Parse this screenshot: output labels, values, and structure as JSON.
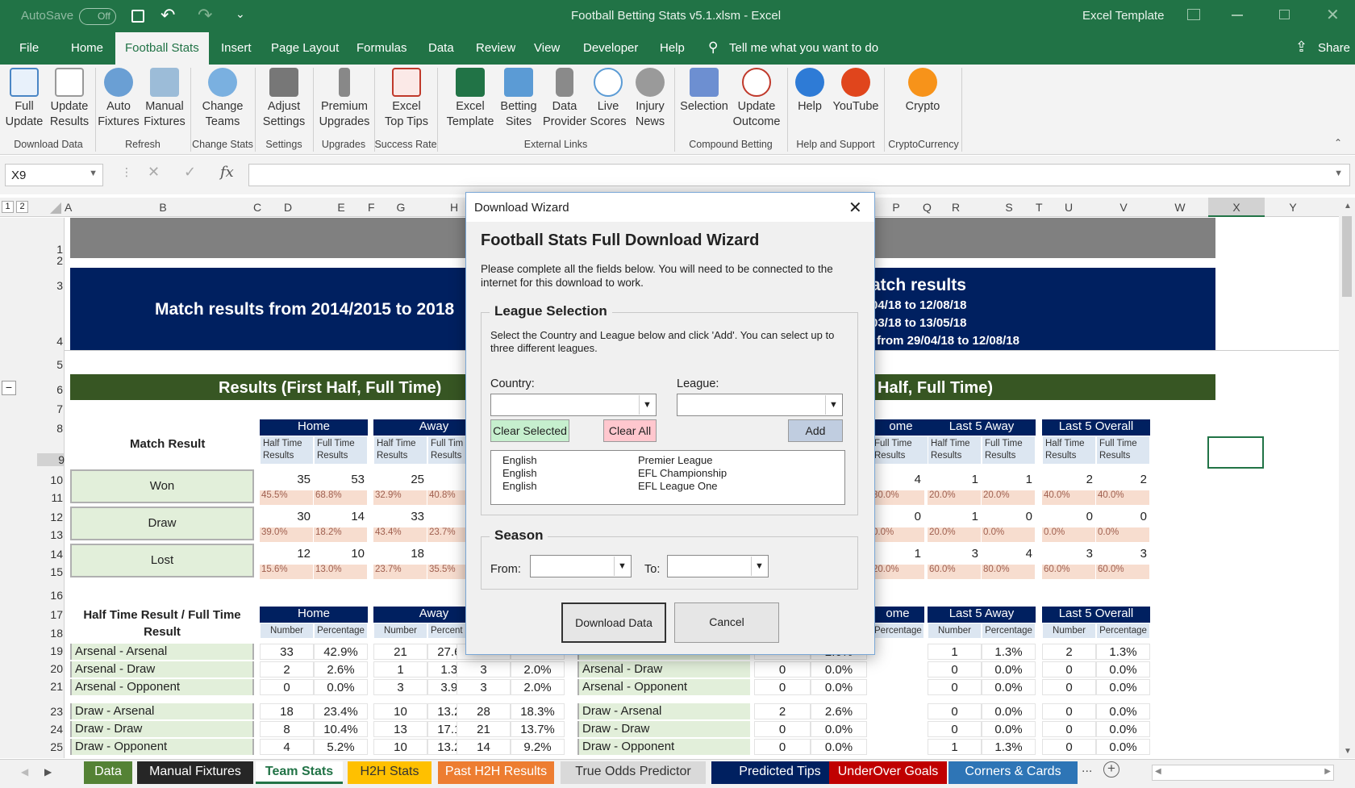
{
  "title_bar": {
    "autosave": "AutoSave",
    "toggle": "Off",
    "doc_title": "Football Betting Stats v5.1.xlsm  -  Excel",
    "template": "Excel Template"
  },
  "menu": [
    "File",
    "Home",
    "Football Stats",
    "Insert",
    "Page Layout",
    "Formulas",
    "Data",
    "Review",
    "View",
    "Developer",
    "Help"
  ],
  "tell_me": "Tell me what you want to do",
  "share": "Share",
  "ribbon": {
    "buttons": [
      {
        "l1": "Full",
        "l2": "Update"
      },
      {
        "l1": "Update",
        "l2": "Results"
      },
      {
        "l1": "Auto",
        "l2": "Fixtures"
      },
      {
        "l1": "Manual",
        "l2": "Fixtures"
      },
      {
        "l1": "Change",
        "l2": "Teams"
      },
      {
        "l1": "Adjust",
        "l2": "Settings"
      },
      {
        "l1": "Premium",
        "l2": "Upgrades"
      },
      {
        "l1": "Excel",
        "l2": "Top Tips"
      },
      {
        "l1": "Excel",
        "l2": "Template"
      },
      {
        "l1": "Betting",
        "l2": "Sites"
      },
      {
        "l1": "Data",
        "l2": "Provider"
      },
      {
        "l1": "Live",
        "l2": "Scores"
      },
      {
        "l1": "Injury",
        "l2": "News"
      },
      {
        "l1": "Selection",
        "l2": ""
      },
      {
        "l1": "Update",
        "l2": "Outcome"
      },
      {
        "l1": "Help",
        "l2": ""
      },
      {
        "l1": "YouTube",
        "l2": ""
      },
      {
        "l1": "Crypto",
        "l2": ""
      }
    ],
    "groups": [
      "Download Data",
      "Refresh",
      "Change Stats",
      "Settings",
      "Upgrades",
      "Success Rate",
      "External Links",
      "Compound Betting",
      "Help and Support",
      "CryptoCurrency"
    ]
  },
  "namebox": "X9",
  "fx": "fx",
  "columns": [
    "A",
    "B",
    "C",
    "D",
    "E",
    "F",
    "G",
    "H",
    "P",
    "Q",
    "R",
    "S",
    "T",
    "U",
    "V",
    "W",
    "X",
    "Y"
  ],
  "rows": [
    "1",
    "2",
    "3",
    "4",
    "5",
    "6",
    "7",
    "8",
    "9",
    "10",
    "11",
    "12",
    "13",
    "14",
    "15",
    "16",
    "17",
    "18",
    "19",
    "20",
    "21",
    "23",
    "24",
    "25"
  ],
  "sheet": {
    "banner_left": "Match results from 2014/2015 to 2018",
    "banner_right": [
      "atch results",
      "04/18 to 12/08/18",
      "03/18 to 13/05/18",
      ") from 29/04/18 to 12/08/18"
    ],
    "section_left": "Results (First Half, Full Time)",
    "section_right": "Half, Full Time)",
    "match_result": "Match Result",
    "home": "Home",
    "away": "Away",
    "ome": "ome",
    "last5away": "Last 5 Away",
    "last5overall": "Last 5 Overall",
    "ht": "Half Time",
    "res": "Results",
    "ft": "Full Time",
    "ft_trunc": "Full Tim",
    "res_trunc": "Results",
    "won": "Won",
    "draw": "Draw",
    "lost": "Lost",
    "vals_left": [
      [
        "35",
        "53",
        "25"
      ],
      [
        "45.5%",
        "68.8%",
        "32.9%",
        "40.8%"
      ],
      [
        "30",
        "14",
        "33"
      ],
      [
        "39.0%",
        "18.2%",
        "43.4%",
        "23.7%"
      ],
      [
        "12",
        "10",
        "18"
      ],
      [
        "15.6%",
        "13.0%",
        "23.7%",
        "35.5%"
      ]
    ],
    "vals_right": [
      [
        "4",
        "1",
        "1",
        "2",
        "2"
      ],
      [
        "30.0%",
        "20.0%",
        "20.0%",
        "40.0%",
        "40.0%"
      ],
      [
        "0",
        "1",
        "0",
        "0",
        "0"
      ],
      [
        "0.0%",
        "20.0%",
        "0.0%",
        "0.0%",
        "0.0%"
      ],
      [
        "1",
        "3",
        "4",
        "3",
        "3"
      ],
      [
        "20.0%",
        "60.0%",
        "80.0%",
        "60.0%",
        "60.0%"
      ]
    ],
    "htft_title": "Half Time Result / Full Time Result",
    "number": "Number",
    "percentage": "Percentage",
    "percent_trunc": "Percent",
    "htft_rows": [
      {
        "label": "Arsenal - Arsenal",
        "a": [
          "33",
          "42.9%",
          "21",
          "27.6%",
          "",
          "",
          "",
          "2.6%",
          "1",
          "1.3%",
          "2",
          "1.3%"
        ],
        "rl": "Arsenal - Arsenal"
      },
      {
        "label": "Arsenal - Draw",
        "a": [
          "2",
          "2.6%",
          "1",
          "1.3%",
          "3",
          "2.0%",
          "0",
          "0.0%",
          "0",
          "0.0%",
          "0",
          "0.0%"
        ],
        "rl": "Arsenal - Draw"
      },
      {
        "label": "Arsenal - Opponent",
        "a": [
          "0",
          "0.0%",
          "3",
          "3.9%",
          "3",
          "2.0%",
          "0",
          "0.0%",
          "0",
          "0.0%",
          "0",
          "0.0%"
        ],
        "rl": "Arsenal - Opponent"
      },
      {
        "label": "Draw - Arsenal",
        "a": [
          "18",
          "23.4%",
          "10",
          "13.2%",
          "28",
          "18.3%",
          "2",
          "2.6%",
          "0",
          "0.0%",
          "0",
          "0.0%"
        ],
        "rl": "Draw - Arsenal"
      },
      {
        "label": "Draw - Draw",
        "a": [
          "8",
          "10.4%",
          "13",
          "17.1%",
          "21",
          "13.7%",
          "0",
          "0.0%",
          "0",
          "0.0%",
          "0",
          "0.0%"
        ],
        "rl": "Draw - Draw"
      },
      {
        "label": "Draw - Opponent",
        "a": [
          "4",
          "5.2%",
          "10",
          "13.2%",
          "14",
          "9.2%",
          "0",
          "0.0%",
          "1",
          "1.3%",
          "0",
          "0.0%"
        ],
        "rl": "Draw - Opponent"
      }
    ]
  },
  "dialog": {
    "window_title": "Download Wizard",
    "heading": "Football Stats Full Download Wizard",
    "intro": "Please complete all the fields below. You will need to be connected to the internet for this download to work.",
    "league_legend": "League Selection",
    "league_help": "Select the Country and League below and click 'Add'. You can select up to three different leagues.",
    "country_label": "Country:",
    "league_label": "League:",
    "clear_selected": "Clear Selected",
    "clear_all": "Clear All",
    "add": "Add",
    "selected": [
      [
        "English",
        "Premier League"
      ],
      [
        "English",
        "EFL Championship"
      ],
      [
        "English",
        "EFL League One"
      ]
    ],
    "season_legend": "Season",
    "from": "From:",
    "to": "To:",
    "download": "Download Data",
    "cancel": "Cancel"
  },
  "tabs": [
    {
      "label": "Data",
      "color": "#548235"
    },
    {
      "label": "Manual Fixtures",
      "color": "#262626"
    },
    {
      "label": "Team Stats",
      "color": "#ffffff"
    },
    {
      "label": "H2H Stats",
      "color": "#ffc000"
    },
    {
      "label": "Past H2H Results",
      "color": "#ed7d31"
    },
    {
      "label": "True Odds Predictor",
      "color": "#d9d9d9"
    },
    {
      "label": "Predicted Tips",
      "color": "#002060"
    },
    {
      "label": "UnderOver Goals",
      "color": "#c00000"
    },
    {
      "label": "Corners & Cards",
      "color": "#2e75b6"
    }
  ],
  "tabs_more": "..."
}
